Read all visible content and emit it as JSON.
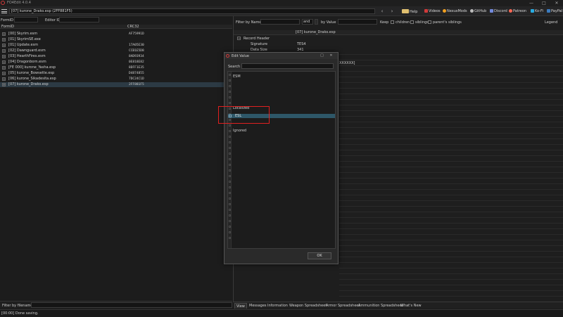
{
  "app": {
    "title": "FO4Edit 4.0.4",
    "accent": "#d03a3a"
  },
  "window_controls": [
    "—",
    "□",
    "✕"
  ],
  "toolbar": {
    "file_path": "[07] kurone_Drako.esp (2FF881F5)",
    "links": [
      {
        "label": "Help",
        "icon": "book-icon",
        "color": "#e0c070"
      },
      {
        "label": "Videos",
        "icon": "video-icon",
        "color": "#d03a3a"
      },
      {
        "label": "NexusMods",
        "icon": "nexus-icon",
        "color": "#f2a020"
      },
      {
        "label": "GitHub",
        "icon": "github-icon",
        "color": "#bbbbbb"
      },
      {
        "label": "Discord",
        "icon": "discord-icon",
        "color": "#7289da"
      },
      {
        "label": "Patreon",
        "icon": "patreon-icon",
        "color": "#f96854"
      },
      {
        "label": "Ko-Fi",
        "icon": "kofi-icon",
        "color": "#29abe0"
      },
      {
        "label": "PayPal",
        "icon": "paypal-icon",
        "color": "#3b7bbf"
      }
    ]
  },
  "left": {
    "formid_label": "FormID",
    "editor_id_label": "Editor ID",
    "columns": {
      "formid": "FormID",
      "crc": "CRC32"
    },
    "rows": [
      {
        "name": "[00] Skyrim.esm",
        "crc": "AF75991D"
      },
      {
        "name": "[01] SkyrimSE.exe",
        "crc": ""
      },
      {
        "name": "[01] Update.esm",
        "crc": "17A05E30"
      },
      {
        "name": "[02] Dawnguard.esm",
        "crc": "CCB1E5D8"
      },
      {
        "name": "[03] HearthFires.esm",
        "crc": "8AD93934"
      },
      {
        "name": "[04] Dragonborn.esm",
        "crc": "0E818E82"
      },
      {
        "name": "[FE 000] kurone_Yasha.esp",
        "crc": "8DFF1E35"
      },
      {
        "name": "[05] kurone_Bowsette.esp",
        "crc": "D4874855"
      },
      {
        "name": "[06] kurone_Sikadesita.esp",
        "crc": "7DC24C1D"
      },
      {
        "name": "[07] kurone_Drako.esp",
        "crc": "2FF881F5"
      }
    ],
    "selected_index": 9,
    "filter_label": "Filter by filename:"
  },
  "right": {
    "filter_by_name": "Filter by Name",
    "and": "and",
    "by_value": "by Value",
    "keep": "Keep",
    "children": "children",
    "siblings": "siblings",
    "parents_siblings": "parent's siblings",
    "legend": "Legend",
    "column_header": "[07] kurone_Drako.esp",
    "record_header": "Record Header",
    "signature_label": "Signature",
    "signature_value": "TES4",
    "datasize_label": "Data Size",
    "datasize_value": "341",
    "partial_value": "XXXXXX]"
  },
  "tabs": [
    "View",
    "Messages",
    "Information",
    "Weapon Spreadsheet",
    "Armor Spreadsheet",
    "Ammunition Spreadsheet",
    "What's New"
  ],
  "active_tab": 0,
  "status": "[00:00] Done saving.",
  "dialog": {
    "title": "Edit Value",
    "search_label": "Search",
    "groups": [
      {
        "label": "ESM"
      },
      {
        "label": "Localized"
      },
      {
        "label": "Ignored"
      }
    ],
    "selected_flag": "ESL",
    "ok_label": "OK"
  }
}
